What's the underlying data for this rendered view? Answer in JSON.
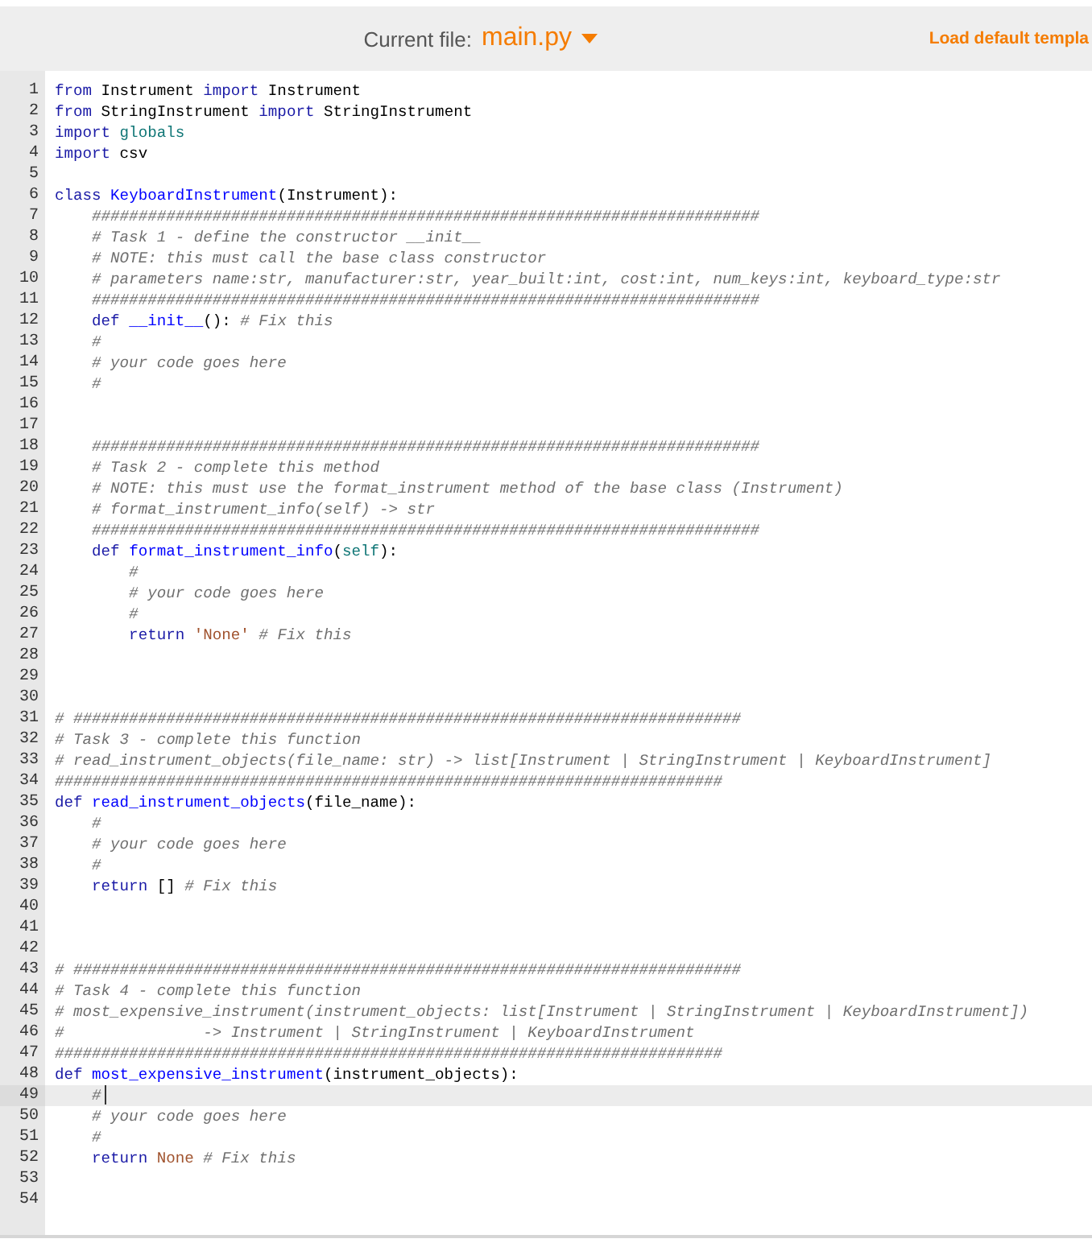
{
  "header": {
    "label": "Current file:",
    "file": "main.py",
    "action": "Load default templa"
  },
  "editor": {
    "lines": [
      {
        "number": "1",
        "current": false,
        "tokens": [
          {
            "kind": "keyword",
            "text": "from"
          },
          {
            "kind": "plain",
            "text": " Instrument "
          },
          {
            "kind": "keyword",
            "text": "import"
          },
          {
            "kind": "plain",
            "text": " Instrument"
          }
        ]
      },
      {
        "number": "2",
        "current": false,
        "tokens": [
          {
            "kind": "keyword",
            "text": "from"
          },
          {
            "kind": "plain",
            "text": " StringInstrument "
          },
          {
            "kind": "keyword",
            "text": "import"
          },
          {
            "kind": "plain",
            "text": " StringInstrument"
          }
        ]
      },
      {
        "number": "3",
        "current": false,
        "tokens": [
          {
            "kind": "keyword",
            "text": "import"
          },
          {
            "kind": "builtin",
            "text": " globals"
          }
        ]
      },
      {
        "number": "4",
        "current": false,
        "tokens": [
          {
            "kind": "keyword",
            "text": "import"
          },
          {
            "kind": "plain",
            "text": " csv"
          }
        ]
      },
      {
        "number": "5",
        "current": false
      },
      {
        "number": "6",
        "current": false,
        "tokens": [
          {
            "kind": "keyword",
            "text": "class"
          },
          {
            "kind": "name",
            "text": " KeyboardInstrument"
          },
          {
            "kind": "plain",
            "text": "(Instrument):"
          }
        ]
      },
      {
        "number": "7",
        "current": false,
        "tokens": [
          {
            "kind": "comment",
            "text": "    ########################################################################"
          }
        ]
      },
      {
        "number": "8",
        "current": false,
        "tokens": [
          {
            "kind": "comment",
            "text": "    # Task 1 - define the constructor __init__"
          }
        ]
      },
      {
        "number": "9",
        "current": false,
        "tokens": [
          {
            "kind": "comment",
            "text": "    # NOTE: this must call the base class constructor"
          }
        ]
      },
      {
        "number": "10",
        "current": false,
        "tokens": [
          {
            "kind": "comment",
            "text": "    # parameters name:str, manufacturer:str, year_built:int, cost:int, num_keys:int, keyboard_type:str"
          }
        ]
      },
      {
        "number": "11",
        "current": false,
        "tokens": [
          {
            "kind": "comment",
            "text": "    ########################################################################"
          }
        ]
      },
      {
        "number": "12",
        "current": false,
        "tokens": [
          {
            "kind": "keyword",
            "text": "    def"
          },
          {
            "kind": "name",
            "text": " __init__"
          },
          {
            "kind": "plain",
            "text": "(): "
          },
          {
            "kind": "comment",
            "text": "# Fix this"
          }
        ]
      },
      {
        "number": "13",
        "current": false,
        "tokens": [
          {
            "kind": "comment",
            "text": "    #"
          }
        ]
      },
      {
        "number": "14",
        "current": false,
        "tokens": [
          {
            "kind": "comment",
            "text": "    # your code goes here"
          }
        ]
      },
      {
        "number": "15",
        "current": false,
        "tokens": [
          {
            "kind": "comment",
            "text": "    #"
          }
        ]
      },
      {
        "number": "16",
        "current": false
      },
      {
        "number": "17",
        "current": false
      },
      {
        "number": "18",
        "current": false,
        "tokens": [
          {
            "kind": "comment",
            "text": "    ########################################################################"
          }
        ]
      },
      {
        "number": "19",
        "current": false,
        "tokens": [
          {
            "kind": "comment",
            "text": "    # Task 2 - complete this method"
          }
        ]
      },
      {
        "number": "20",
        "current": false,
        "tokens": [
          {
            "kind": "comment",
            "text": "    # NOTE: this must use the format_instrument method of the base class (Instrument)"
          }
        ]
      },
      {
        "number": "21",
        "current": false,
        "tokens": [
          {
            "kind": "comment",
            "text": "    # format_instrument_info(self) -> str"
          }
        ]
      },
      {
        "number": "22",
        "current": false,
        "tokens": [
          {
            "kind": "comment",
            "text": "    ########################################################################"
          }
        ]
      },
      {
        "number": "23",
        "current": false,
        "tokens": [
          {
            "kind": "keyword",
            "text": "    def"
          },
          {
            "kind": "name",
            "text": " format_instrument_info"
          },
          {
            "kind": "plain",
            "text": "("
          },
          {
            "kind": "builtin",
            "text": "self"
          },
          {
            "kind": "plain",
            "text": "):"
          }
        ]
      },
      {
        "number": "24",
        "current": false,
        "tokens": [
          {
            "kind": "comment",
            "text": "        #"
          }
        ]
      },
      {
        "number": "25",
        "current": false,
        "tokens": [
          {
            "kind": "comment",
            "text": "        # your code goes here"
          }
        ]
      },
      {
        "number": "26",
        "current": false,
        "tokens": [
          {
            "kind": "comment",
            "text": "        #"
          }
        ]
      },
      {
        "number": "27",
        "current": false,
        "tokens": [
          {
            "kind": "keyword",
            "text": "        return"
          },
          {
            "kind": "string",
            "text": " 'None'"
          },
          {
            "kind": "comment",
            "text": " # Fix this"
          }
        ]
      },
      {
        "number": "28",
        "current": false
      },
      {
        "number": "29",
        "current": false
      },
      {
        "number": "30",
        "current": false
      },
      {
        "number": "31",
        "current": false,
        "tokens": [
          {
            "kind": "comment",
            "text": "# ########################################################################"
          }
        ]
      },
      {
        "number": "32",
        "current": false,
        "tokens": [
          {
            "kind": "comment",
            "text": "# Task 3 - complete this function"
          }
        ]
      },
      {
        "number": "33",
        "current": false,
        "tokens": [
          {
            "kind": "comment",
            "text": "# read_instrument_objects(file_name: str) -> list[Instrument | StringInstrument | KeyboardInstrument]"
          }
        ]
      },
      {
        "number": "34",
        "current": false,
        "tokens": [
          {
            "kind": "comment",
            "text": "########################################################################"
          }
        ]
      },
      {
        "number": "35",
        "current": false,
        "tokens": [
          {
            "kind": "keyword",
            "text": "def"
          },
          {
            "kind": "name",
            "text": " read_instrument_objects"
          },
          {
            "kind": "plain",
            "text": "(file_name):"
          }
        ]
      },
      {
        "number": "36",
        "current": false,
        "tokens": [
          {
            "kind": "comment",
            "text": "    #"
          }
        ]
      },
      {
        "number": "37",
        "current": false,
        "tokens": [
          {
            "kind": "comment",
            "text": "    # your code goes here"
          }
        ]
      },
      {
        "number": "38",
        "current": false,
        "tokens": [
          {
            "kind": "comment",
            "text": "    #"
          }
        ]
      },
      {
        "number": "39",
        "current": false,
        "tokens": [
          {
            "kind": "keyword",
            "text": "    return"
          },
          {
            "kind": "plain",
            "text": " [] "
          },
          {
            "kind": "comment",
            "text": "# Fix this"
          }
        ]
      },
      {
        "number": "40",
        "current": false
      },
      {
        "number": "41",
        "current": false
      },
      {
        "number": "42",
        "current": false
      },
      {
        "number": "43",
        "current": false,
        "tokens": [
          {
            "kind": "comment",
            "text": "# ########################################################################"
          }
        ]
      },
      {
        "number": "44",
        "current": false,
        "tokens": [
          {
            "kind": "comment",
            "text": "# Task 4 - complete this function"
          }
        ]
      },
      {
        "number": "45",
        "current": false,
        "tokens": [
          {
            "kind": "comment",
            "text": "# most_expensive_instrument(instrument_objects: list[Instrument | StringInstrument | KeyboardInstrument])"
          }
        ]
      },
      {
        "number": "46",
        "current": false,
        "tokens": [
          {
            "kind": "comment",
            "text": "#               -> Instrument | StringInstrument | KeyboardInstrument"
          }
        ]
      },
      {
        "number": "47",
        "current": false,
        "tokens": [
          {
            "kind": "comment",
            "text": "########################################################################"
          }
        ]
      },
      {
        "number": "48",
        "current": false,
        "tokens": [
          {
            "kind": "keyword",
            "text": "def"
          },
          {
            "kind": "name",
            "text": " most_expensive_instrument"
          },
          {
            "kind": "plain",
            "text": "(instrument_objects):"
          }
        ]
      },
      {
        "number": "49",
        "current": true,
        "tokens": [
          {
            "kind": "comment",
            "text": "    #"
          }
        ]
      },
      {
        "number": "50",
        "current": false,
        "tokens": [
          {
            "kind": "comment",
            "text": "    # your code goes here"
          }
        ]
      },
      {
        "number": "51",
        "current": false,
        "tokens": [
          {
            "kind": "comment",
            "text": "    #"
          }
        ]
      },
      {
        "number": "52",
        "current": false,
        "tokens": [
          {
            "kind": "keyword",
            "text": "    return"
          },
          {
            "kind": "constant",
            "text": " None"
          },
          {
            "kind": "comment",
            "text": " # Fix this"
          }
        ]
      },
      {
        "number": "53",
        "current": false
      },
      {
        "number": "54",
        "current": false
      }
    ]
  }
}
